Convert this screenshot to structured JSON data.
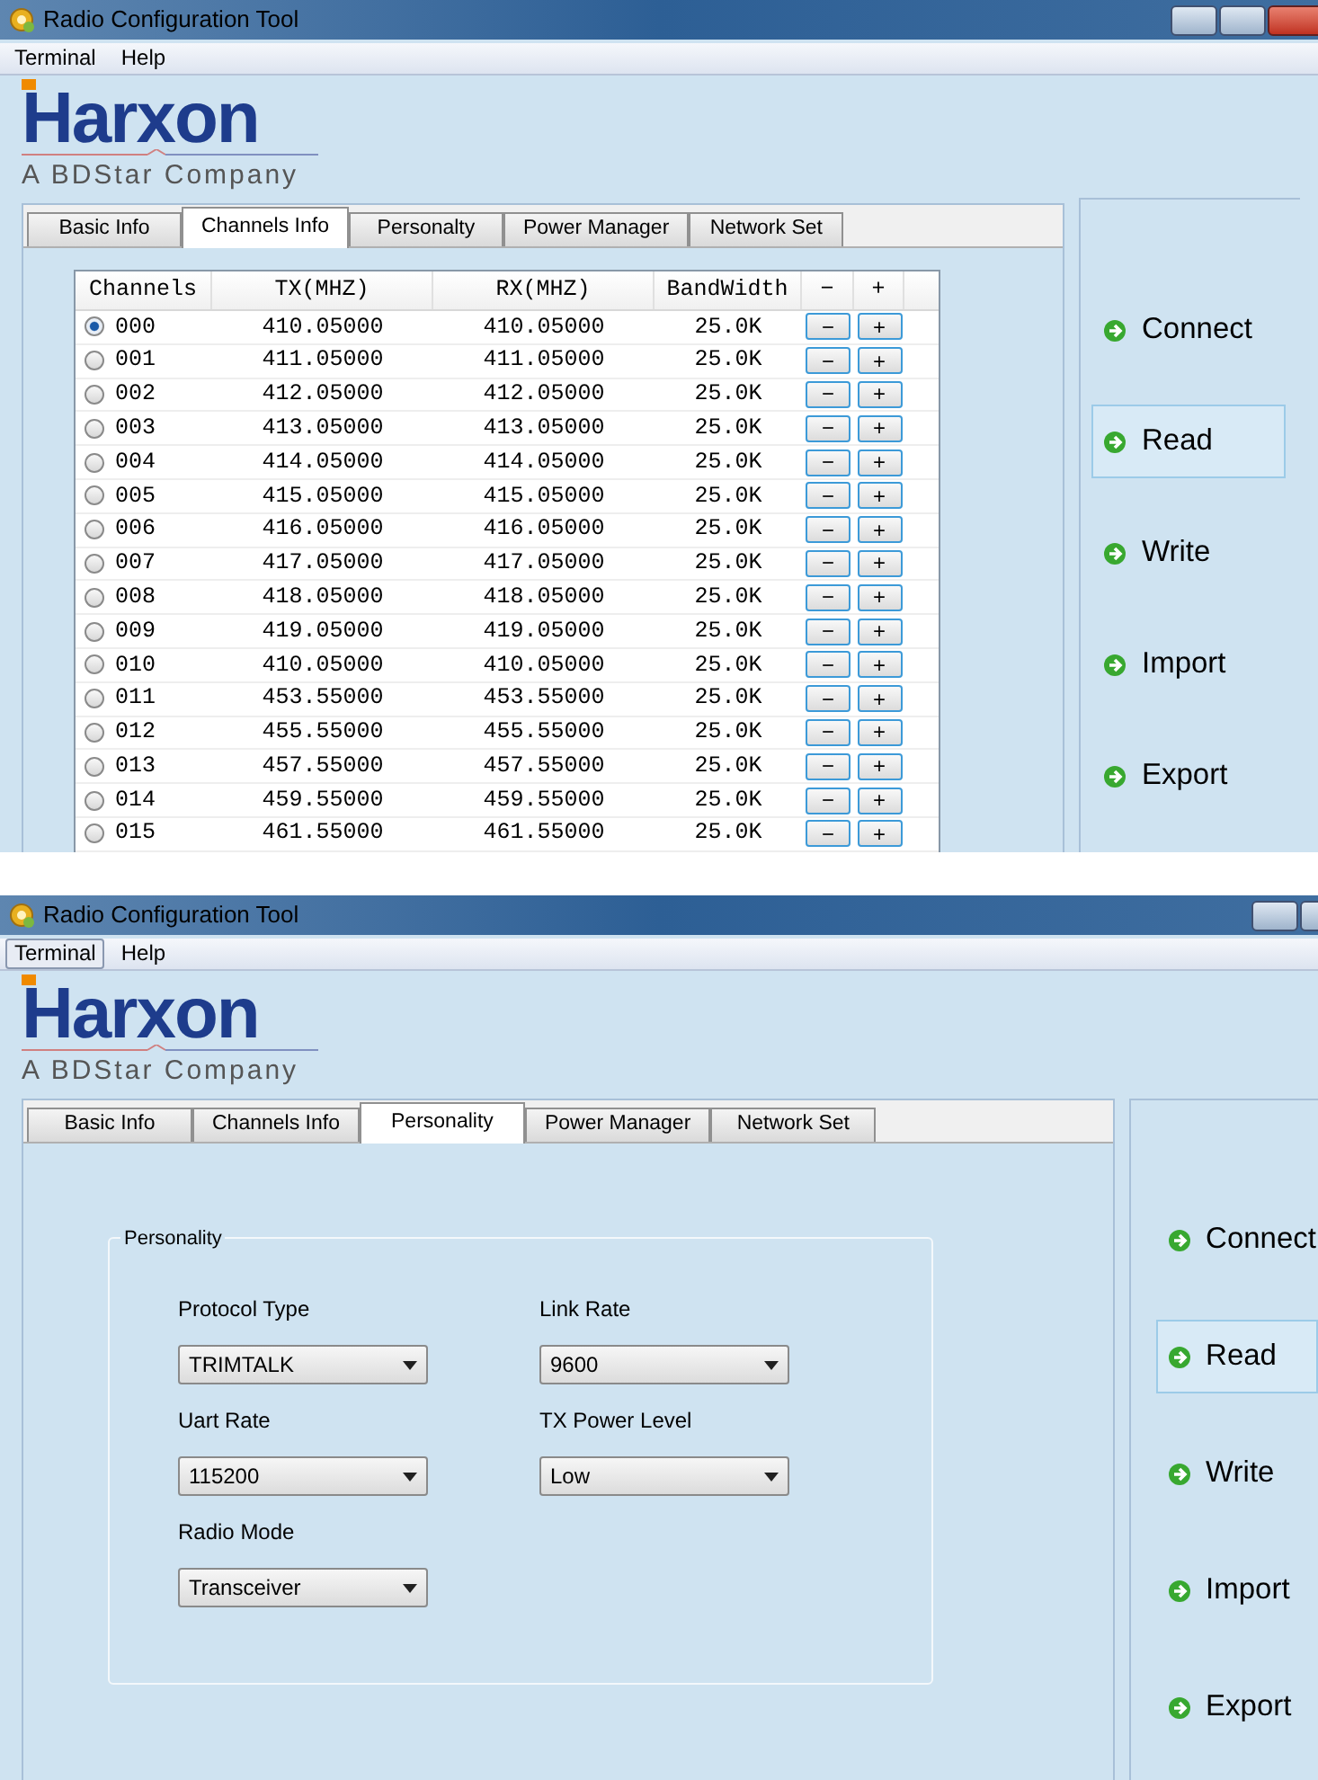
{
  "screens": [
    {
      "window": {
        "title": "Radio Configuration Tool"
      },
      "menu": [
        {
          "label": "Terminal",
          "highlighted": false
        },
        {
          "label": "Help",
          "highlighted": false
        }
      ],
      "logo": {
        "name": "Harxon",
        "tagline": "A BDStar Company"
      },
      "tabs": [
        {
          "label": "Basic Info",
          "selected": false
        },
        {
          "label": "Channels Info",
          "selected": true
        },
        {
          "label": "Personalty",
          "selected": false
        },
        {
          "label": "Power Manager",
          "selected": false
        },
        {
          "label": "Network Set",
          "selected": false
        }
      ],
      "content": {
        "kind": "channels",
        "columns": [
          "Channels",
          "TX(MHZ)",
          "RX(MHZ)",
          "BandWidth",
          "−",
          "+"
        ],
        "rows": [
          {
            "channel": "000",
            "tx": "410.05000",
            "rx": "410.05000",
            "bandwidth": "25.0K",
            "minus": "−",
            "plus": "+",
            "selected": true
          },
          {
            "channel": "001",
            "tx": "411.05000",
            "rx": "411.05000",
            "bandwidth": "25.0K",
            "minus": "−",
            "plus": "+",
            "selected": false
          },
          {
            "channel": "002",
            "tx": "412.05000",
            "rx": "412.05000",
            "bandwidth": "25.0K",
            "minus": "−",
            "plus": "+",
            "selected": false
          },
          {
            "channel": "003",
            "tx": "413.05000",
            "rx": "413.05000",
            "bandwidth": "25.0K",
            "minus": "−",
            "plus": "+",
            "selected": false
          },
          {
            "channel": "004",
            "tx": "414.05000",
            "rx": "414.05000",
            "bandwidth": "25.0K",
            "minus": "−",
            "plus": "+",
            "selected": false
          },
          {
            "channel": "005",
            "tx": "415.05000",
            "rx": "415.05000",
            "bandwidth": "25.0K",
            "minus": "−",
            "plus": "+",
            "selected": false
          },
          {
            "channel": "006",
            "tx": "416.05000",
            "rx": "416.05000",
            "bandwidth": "25.0K",
            "minus": "−",
            "plus": "+",
            "selected": false
          },
          {
            "channel": "007",
            "tx": "417.05000",
            "rx": "417.05000",
            "bandwidth": "25.0K",
            "minus": "−",
            "plus": "+",
            "selected": false
          },
          {
            "channel": "008",
            "tx": "418.05000",
            "rx": "418.05000",
            "bandwidth": "25.0K",
            "minus": "−",
            "plus": "+",
            "selected": false
          },
          {
            "channel": "009",
            "tx": "419.05000",
            "rx": "419.05000",
            "bandwidth": "25.0K",
            "minus": "−",
            "plus": "+",
            "selected": false
          },
          {
            "channel": "010",
            "tx": "410.05000",
            "rx": "410.05000",
            "bandwidth": "25.0K",
            "minus": "−",
            "plus": "+",
            "selected": false
          },
          {
            "channel": "011",
            "tx": "453.55000",
            "rx": "453.55000",
            "bandwidth": "25.0K",
            "minus": "−",
            "plus": "+",
            "selected": false
          },
          {
            "channel": "012",
            "tx": "455.55000",
            "rx": "455.55000",
            "bandwidth": "25.0K",
            "minus": "−",
            "plus": "+",
            "selected": false
          },
          {
            "channel": "013",
            "tx": "457.55000",
            "rx": "457.55000",
            "bandwidth": "25.0K",
            "minus": "−",
            "plus": "+",
            "selected": false
          },
          {
            "channel": "014",
            "tx": "459.55000",
            "rx": "459.55000",
            "bandwidth": "25.0K",
            "minus": "−",
            "plus": "+",
            "selected": false
          },
          {
            "channel": "015",
            "tx": "461.55000",
            "rx": "461.55000",
            "bandwidth": "25.0K",
            "minus": "−",
            "plus": "+",
            "selected": false
          }
        ]
      },
      "side_buttons": [
        {
          "label": "Connect",
          "highlighted": false
        },
        {
          "label": "Read",
          "highlighted": true
        },
        {
          "label": "Write",
          "highlighted": false
        },
        {
          "label": "Import",
          "highlighted": false
        },
        {
          "label": "Export",
          "highlighted": false
        }
      ]
    },
    {
      "window": {
        "title": "Radio Configuration Tool"
      },
      "menu": [
        {
          "label": "Terminal",
          "highlighted": true
        },
        {
          "label": "Help",
          "highlighted": false
        }
      ],
      "logo": {
        "name": "Harxon",
        "tagline": "A BDStar Company"
      },
      "tabs": [
        {
          "label": "Basic Info",
          "selected": false
        },
        {
          "label": "Channels Info",
          "selected": false
        },
        {
          "label": "Personality",
          "selected": true
        },
        {
          "label": "Power Manager",
          "selected": false
        },
        {
          "label": "Network Set",
          "selected": false
        }
      ],
      "content": {
        "kind": "personality",
        "group_title": "Personality",
        "fields": [
          {
            "label": "Protocol Type",
            "value": "TRIMTALK"
          },
          {
            "label": "Link Rate",
            "value": "9600"
          },
          {
            "label": "Uart Rate",
            "value": "115200"
          },
          {
            "label": "TX Power Level",
            "value": "Low"
          },
          {
            "label": "Radio Mode",
            "value": "Transceiver"
          }
        ]
      },
      "side_buttons": [
        {
          "label": "Connect",
          "highlighted": false
        },
        {
          "label": "Read",
          "highlighted": true
        },
        {
          "label": "Write",
          "highlighted": false
        },
        {
          "label": "Import",
          "highlighted": false
        },
        {
          "label": "Export",
          "highlighted": false
        }
      ]
    }
  ]
}
